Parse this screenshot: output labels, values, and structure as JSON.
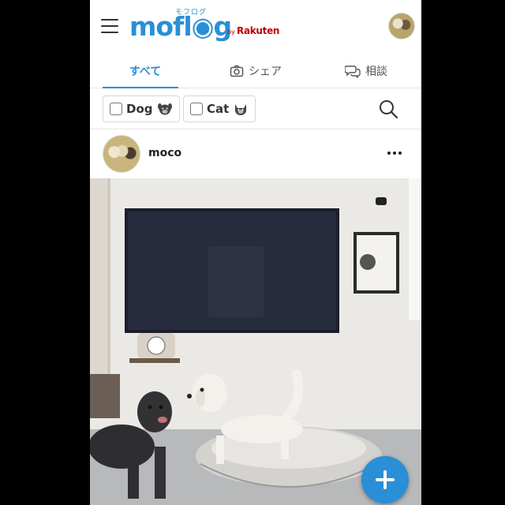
{
  "header": {
    "logo_ruby": "モフログ",
    "logo_word": "mofl◉g",
    "logo_by": "by",
    "logo_brand": "Rakuten"
  },
  "tabs": [
    {
      "label": "すべて",
      "icon": "",
      "active": true
    },
    {
      "label": "シェア",
      "icon": "camera-icon",
      "active": false
    },
    {
      "label": "相談",
      "icon": "chat-bubbles-icon",
      "active": false
    }
  ],
  "filters": [
    {
      "label": "Dog",
      "pet_icon": "dog-face-icon",
      "checked": false
    },
    {
      "label": "Cat",
      "pet_icon": "cat-face-icon",
      "checked": false
    }
  ],
  "post": {
    "username": "moco"
  },
  "colors": {
    "brand_blue": "#2a8fd6",
    "rakuten_red": "#bf0000"
  }
}
